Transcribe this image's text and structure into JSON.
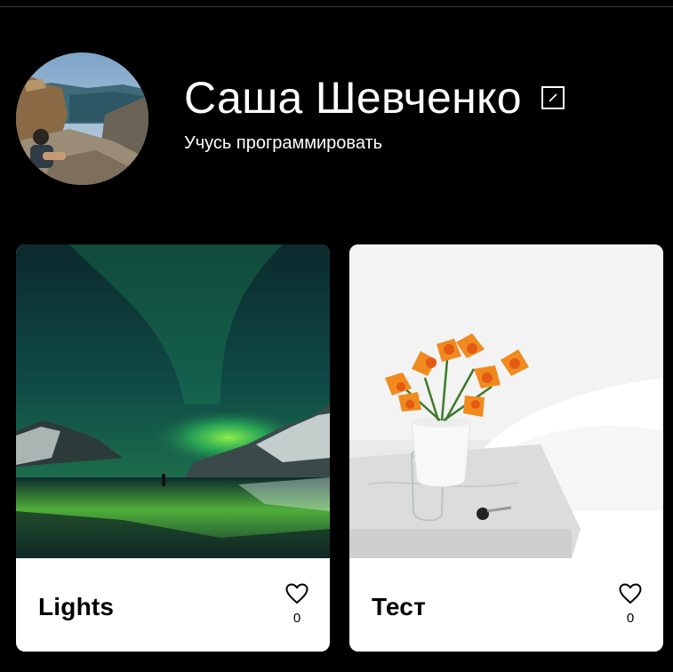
{
  "profile": {
    "name": "Саша Шевченко",
    "about": "Учусь программировать",
    "avatar_icon": "person-on-cliff-photo"
  },
  "edit_icon": "pencil-icon",
  "cards": [
    {
      "title": "Lights",
      "likes": "0",
      "image": "aurora-photo",
      "like_icon": "heart-outline-icon"
    },
    {
      "title": "Тест",
      "likes": "0",
      "image": "lilies-vase-photo",
      "like_icon": "heart-outline-icon"
    }
  ],
  "colors": {
    "background": "#000000",
    "card": "#ffffff",
    "text_light": "#ffffff",
    "text_dark": "#000000"
  }
}
